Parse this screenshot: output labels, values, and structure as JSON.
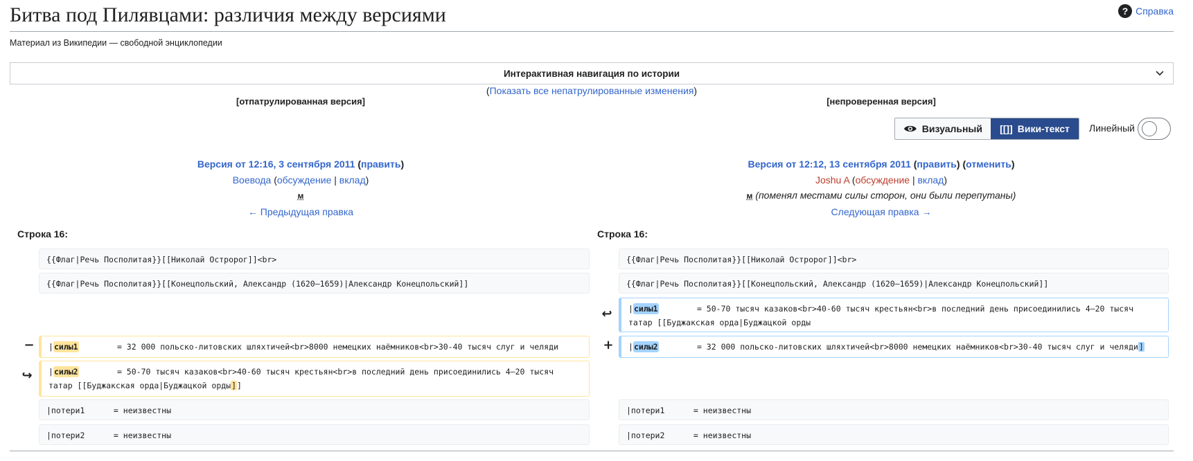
{
  "header": {
    "title": "Битва под Пилявцами: различия между версиями",
    "help_label": "Справка",
    "subtitle": "Материал из Википедии — свободной энциклопедии"
  },
  "navigation": {
    "title": "Интерактивная навигация по истории",
    "show_all_open": "(",
    "show_all_link": "Показать все непатрулированные изменения",
    "show_all_close": ")",
    "left_status": "[отпатрулированная версия]",
    "right_status": "[непроверенная версия]"
  },
  "view_toggle": {
    "visual_label": "Визуальный",
    "wikitext_icon": "[[]]",
    "wikitext_label": "Вики-текст",
    "linear_label": "Линейный",
    "active": "Вики-текст",
    "linear_enabled": false
  },
  "left_version": {
    "title": "Версия от 12:16, 3 сентября 2011",
    "edit_link": "править",
    "user": "Воевода",
    "talk_link": "обсуждение",
    "contrib_link": "вклад",
    "minor_mark": "м",
    "prev_link": "← Предыдущая правка"
  },
  "right_version": {
    "title": "Версия от 12:12, 13 сентября 2011",
    "edit_link": "править",
    "undo_link": "отменить",
    "user": "Joshu A",
    "talk_link": "обсуждение",
    "contrib_link": "вклад",
    "minor_mark": "м",
    "summary": "(поменял местами силы сторон, они были перепутаны)",
    "next_link": "Следующая правка →"
  },
  "diff": {
    "left_line_label": "Строка 16:",
    "right_line_label": "Строка 16:",
    "context1": "{{Флаг|Речь Посполитая}}[[Николай Остророг]]<br>",
    "context2": "{{Флаг|Речь Посполитая}}[[Конецпольский, Александр (1620—1659)|Александр Конецпольский]]",
    "moved_right_key": "силы1",
    "moved_right_text": "        = 50-70 тысяч казаков<br>40-60 тысяч крестьян<br>в последний день присоединились 4—20 тысяч татар [[Буджакская орда|Буджацкой орды",
    "deleted_key": "силы1",
    "deleted_text": "        = 32 000 польско-литовских шляхтичей<br>8000 немецких наёмников<br>30-40 тысяч слуг и челяди",
    "added_key": "силы2",
    "added_text": "        = 32 000 польско-литовских шляхтичей<br>8000 немецких наёмников<br>30-40 тысяч слуг и челяди",
    "added_tail": "]",
    "moved_left_key": "силы2",
    "moved_left_text": "        = 50-70 тысяч казаков<br>40-60 тысяч крестьян<br>в последний день присоединились 4—20 тысяч татар [[Буджакская орда|Буджацкой орды",
    "moved_left_tail": "]",
    "moved_left_end": "]",
    "context3": "|потери1      = неизвестны",
    "context4": "|потери2      = неизвестны",
    "pipe": "|",
    "minus_marker": "−",
    "plus_marker": "+",
    "moved_marker_right": "↩",
    "moved_marker_left": "↪"
  },
  "colors": {
    "link": "#3366cc",
    "red_link": "#bf3c2c",
    "deleted": "#ffe49c",
    "added": "#a3d3ff",
    "active_toggle": "#2a4b8d"
  }
}
